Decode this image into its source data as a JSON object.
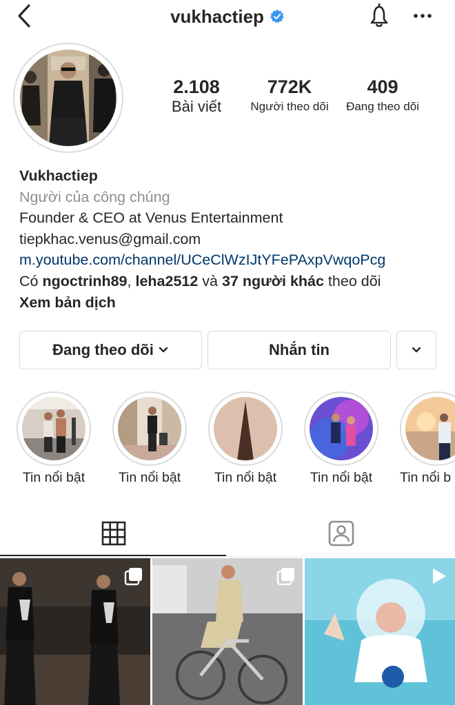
{
  "header": {
    "username": "vukhactiep",
    "verified_color": "#3897f0",
    "icons": [
      "back-arrow-icon",
      "verified-badge-icon",
      "bell-icon",
      "more-icon"
    ]
  },
  "stats": {
    "posts": {
      "count": "2.108",
      "label": "Bài viết"
    },
    "followers": {
      "count": "772K",
      "label": "Người theo dõi"
    },
    "following": {
      "count": "409",
      "label": "Đang theo dõi"
    }
  },
  "bio": {
    "name": "Vukhactiep",
    "category": "Người của công chúng",
    "line1": "Founder & CEO at Venus Entertainment",
    "email": "tiepkhac.venus@gmail.com",
    "link": "m.youtube.com/channel/UCeClWzIJtYFePAxpVwqoPcg",
    "followed_by_prefix": "Có ",
    "followed_by_user1": "ngoctrinh89",
    "followed_by_sep": ", ",
    "followed_by_user2": "leha2512",
    "followed_by_and": " và ",
    "followed_by_others": "37 người khác",
    "followed_by_suffix": " theo dõi",
    "see_translation": "Xem bản dịch",
    "link_color": "#00376b"
  },
  "actions": {
    "following_label": "Đang theo dõi",
    "message_label": "Nhắn tin"
  },
  "highlights": [
    {
      "label": "Tin nổi bật"
    },
    {
      "label": "Tin nổi bật"
    },
    {
      "label": "Tin nổi bật"
    },
    {
      "label": "Tin nổi bật"
    },
    {
      "label": "Tin nổi b"
    }
  ],
  "tabs": [
    "grid-icon",
    "tagged-icon"
  ],
  "posts": [
    {
      "type": "multi-photo",
      "icon": "carousel-icon"
    },
    {
      "type": "multi-photo",
      "icon": "carousel-icon"
    },
    {
      "type": "video",
      "icon": "play-icon"
    }
  ]
}
